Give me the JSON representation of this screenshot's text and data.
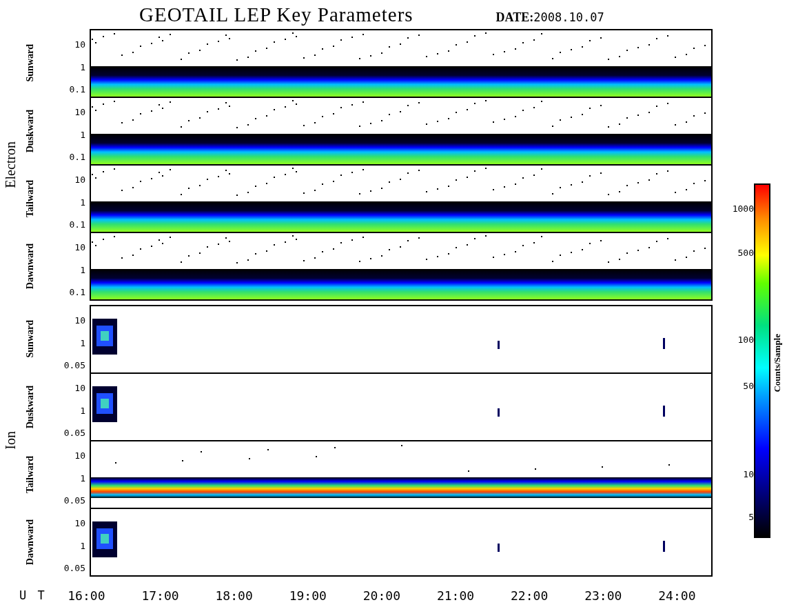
{
  "title": "GEOTAIL LEP Key Parameters",
  "date": {
    "label": "DATE:",
    "value": "2008.10.07"
  },
  "groups": [
    {
      "name": "Electron",
      "panels": [
        {
          "direction": "Sunward",
          "kind": "dense",
          "y_ticks": [
            "10",
            "1",
            "0.1"
          ]
        },
        {
          "direction": "Duskward",
          "kind": "dense",
          "y_ticks": [
            "10",
            "1",
            "0.1"
          ]
        },
        {
          "direction": "Tailward",
          "kind": "dense",
          "y_ticks": [
            "10",
            "1",
            "0.1"
          ]
        },
        {
          "direction": "Dawnward",
          "kind": "dense",
          "y_ticks": [
            "10",
            "1",
            "0.1"
          ]
        }
      ]
    },
    {
      "name": "Ion",
      "panels": [
        {
          "direction": "Sunward",
          "kind": "sparse",
          "y_ticks": [
            "10",
            "1",
            "0.05"
          ]
        },
        {
          "direction": "Duskward",
          "kind": "sparse",
          "y_ticks": [
            "10",
            "1",
            "0.05"
          ]
        },
        {
          "direction": "Tailward",
          "kind": "band",
          "y_ticks": [
            "10",
            "1",
            "0.05"
          ]
        },
        {
          "direction": "Dawnward",
          "kind": "sparse",
          "y_ticks": [
            "10",
            "1",
            "0.05"
          ]
        }
      ]
    }
  ],
  "x_axis": {
    "label": "U T",
    "ticks": [
      "16:00",
      "17:00",
      "18:00",
      "19:00",
      "20:00",
      "21:00",
      "22:00",
      "23:00",
      "24:00"
    ]
  },
  "colorbar": {
    "label": "Counts/Sample",
    "ticks": [
      "1000",
      "500",
      "100",
      "50",
      "10",
      "5"
    ]
  }
}
